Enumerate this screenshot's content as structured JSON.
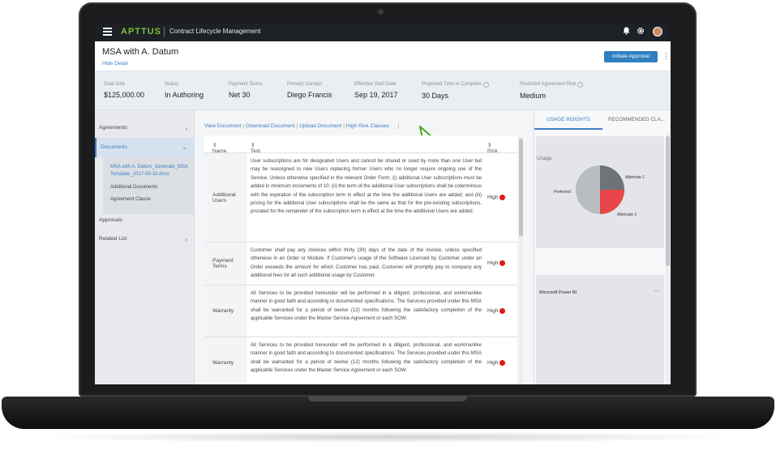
{
  "topbar": {
    "brand": "APTTUS",
    "app_title": "Contract Lifecycle Management",
    "icons": [
      "menu-icon",
      "bell-icon",
      "gear-icon",
      "avatar"
    ]
  },
  "header": {
    "title": "MSA with A. Datum",
    "hide_detail": "Hide Detail",
    "primary_button": "Initiate Approval"
  },
  "summary": {
    "deal_size": {
      "label": "Deal Size",
      "value": "$125,000.00"
    },
    "status": {
      "label": "Status",
      "value": "In Authoring"
    },
    "payment_terms": {
      "label": "Payment Terms",
      "value": "Net 30"
    },
    "primary_contact": {
      "label": "Primary Contact",
      "value": "Diego Francis"
    },
    "effective_start": {
      "label": "Effective Start Date",
      "value": "Sep 19, 2017"
    },
    "projected_time": {
      "label": "Projected Time to Complete",
      "value": "30 Days"
    },
    "predicted_risk": {
      "label": "Predicted Agreement Risk",
      "value": "Medium"
    }
  },
  "leftnav": {
    "agreements": "Agreements",
    "documents": "Documents",
    "doc_file": "MSA with A. Datum_Generate_MSA Template_2017-09-19.docs",
    "additional_documents": "Additional Documents",
    "agreement_clause": "Agreement Clause",
    "approvals": "Approvals",
    "related_list": "Related List"
  },
  "links": {
    "view": "View Document",
    "download": "Download Document",
    "upload": "Upload Document",
    "high_risk": "High Risk Clauses"
  },
  "table": {
    "headers": {
      "name": "Name",
      "text": "Text",
      "risk": "Risk"
    },
    "rows": [
      {
        "name": "Additional Users",
        "text": "User subscriptions are for designated Users and cannot be shared or used by more than one User but may be reassigned to new Users replacing former Users who no longer require ongoing use of the Service. Unless otherwise specified in the relevant Order Form, (i) additional User subscriptions must be added in minimum increments of 10; (ii) the term of the additional User subscriptions shall be coterminous with the expiration of the subscription term in effect at the time the additional Users are added; and (iii) pricing for the additional User subscriptions shall be the same as that for the pre-existing subscriptions, prorated for the remainder of the subscription term in effect at the time the additional Users are added.",
        "risk": "High"
      },
      {
        "name": "Payment Terms",
        "text": "Customer shall pay any invoices within thirty (30) days of the date of the invoice, unless specified otherwise in an Order or Module. If Customer's usage of the Software Licensed by Customer under an Order exceeds the amount for which Customer has paid, Customer will promptly pay to company any additional fees for all such additional usage by Customer.",
        "risk": "High"
      },
      {
        "name": "Warranty",
        "text": "All Services to be provided hereunder will be performed in a diligent, professional, and workmanlike manner in good faith and according to documented specifications. The Services provided under this MSA shall be warranted for a period of twelve (12) months following the satisfactory completion of the applicable Services under the Master Service Agreement or each SOW.",
        "risk": "High"
      },
      {
        "name": "Warranty",
        "text": "All Services to be provided hereunder will be performed in a diligent, professional, and workmanlike manner in good faith and according to documented specifications. The Services provided under this MSA shall be warranted for a period of twelve (12) months following the satisfactory completion of the applicable Services under the Master Service Agreement or each SOW.",
        "risk": "High"
      }
    ]
  },
  "rightpanel": {
    "tab_insights": "USAGE INSIGHTS",
    "tab_recommended": "RECOMMENDED CLA...",
    "usage_title": "Usage",
    "pie_labels": {
      "a1": "Alternate 1",
      "a2": "Alternate 2",
      "pref": "Preferred"
    },
    "pbi_title": "Microsoft Power BI",
    "colors": {
      "preferred": "#b9bcc1",
      "alternate1": "#6e737a",
      "alternate2": "#e8464a"
    }
  }
}
